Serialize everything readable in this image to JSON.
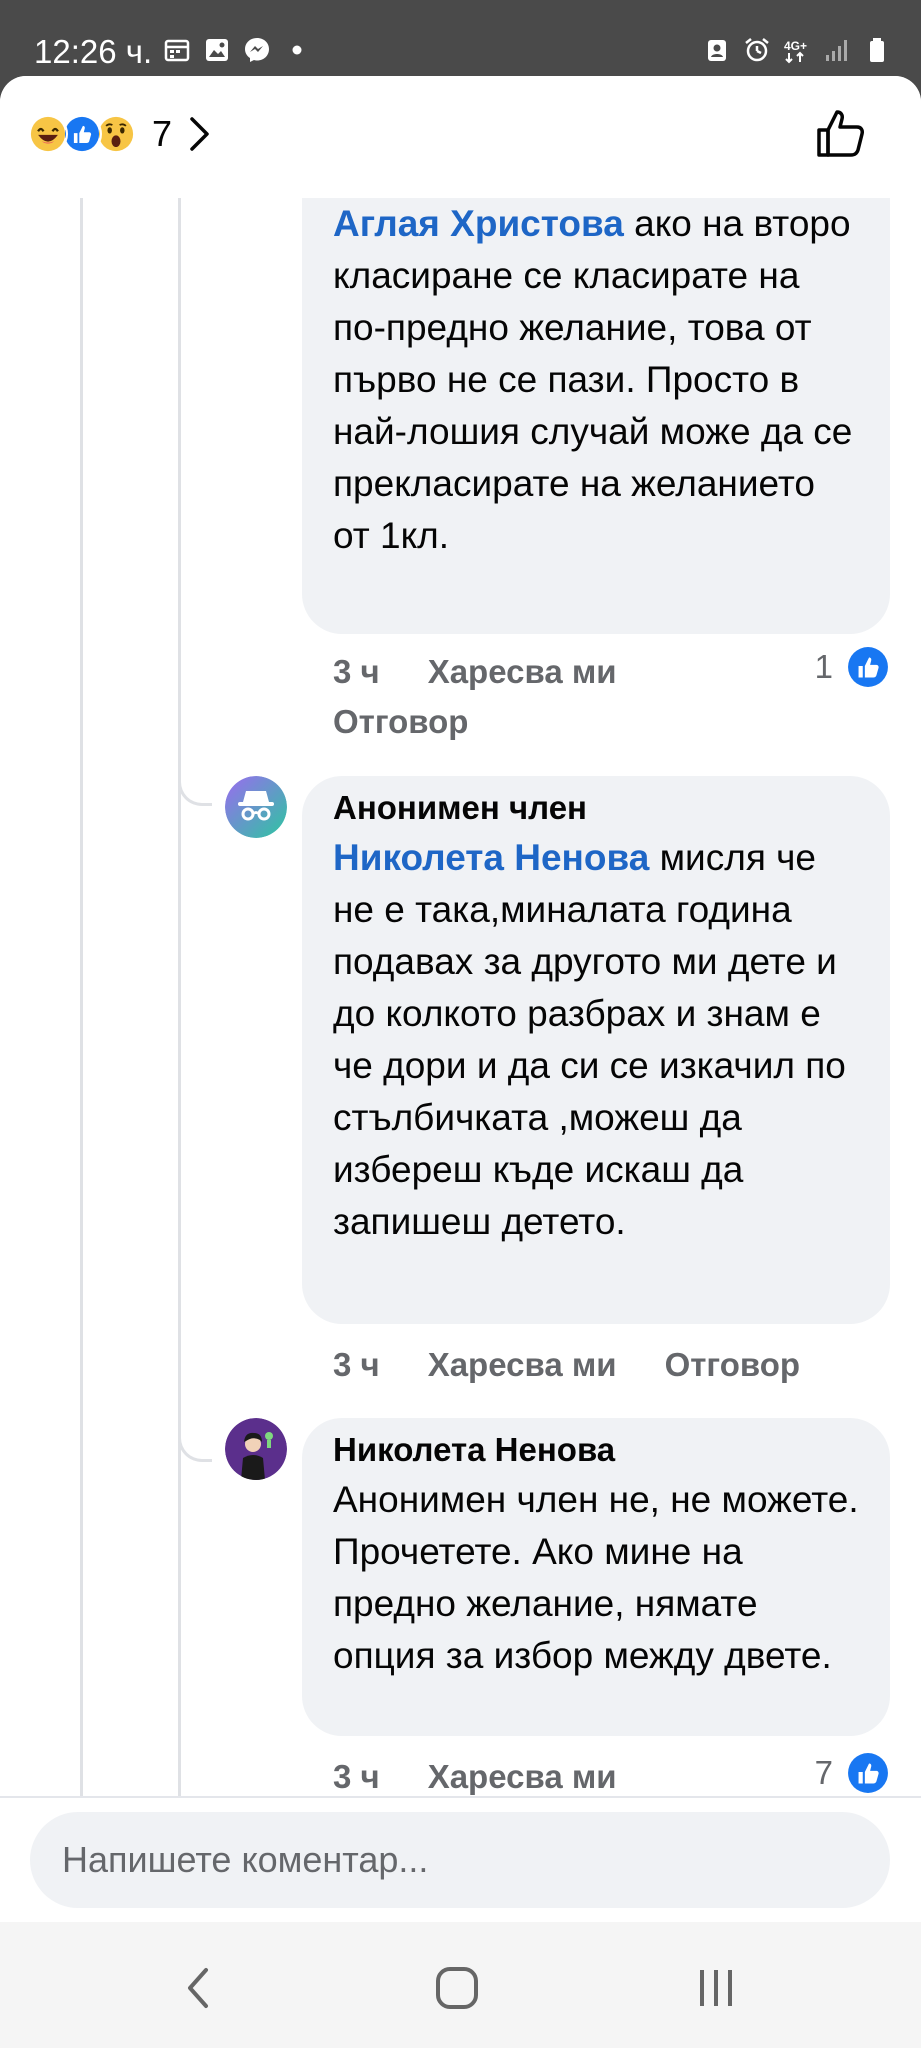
{
  "status_bar": {
    "time": "12:26 ч.",
    "left_icons": [
      "calendar-icon",
      "gallery-icon",
      "messenger-icon",
      "dot-icon"
    ],
    "right_icons": [
      "contacts-icon",
      "alarm-icon",
      "network-4g-icon",
      "signal-icon",
      "battery-icon"
    ],
    "network_label": "4G+"
  },
  "header": {
    "reactions": [
      "haha",
      "like",
      "wow"
    ],
    "reaction_count": "7"
  },
  "comments": [
    {
      "mention": "Аглая Христова",
      "text": " ако на второ класиране се класирате на по-предно желание, това от първо не се пази. Просто в най-лошия случай може да се прекласирате на желанието от 1кл.",
      "time": "3 ч",
      "like_label": "Харесва ми",
      "reply_label": "Отговор",
      "likes": "1"
    },
    {
      "author": "Анонимен член",
      "mention": "Николета Ненова",
      "text": " мисля че не е така,миналата година подавах за другото ми дете и до колкото разбрах и знам е че дори и да си се изкачил по стълбичката ,можеш да избереш къде искаш да запишеш детето.",
      "time": "3 ч",
      "like_label": "Харесва ми",
      "reply_label": "Отговор"
    },
    {
      "author": "Николета Ненова",
      "text": "Анонимен член не, не можете. Прочетете. Ако мине на предно желание, нямате опция за избор между двете.",
      "time": "3 ч",
      "like_label": "Харесва ми",
      "likes": "7"
    }
  ],
  "composer": {
    "placeholder": "Напишете коментар..."
  },
  "colors": {
    "mention": "#1e66c6",
    "bubble": "#f0f2f5",
    "like_blue": "#1877f2"
  }
}
